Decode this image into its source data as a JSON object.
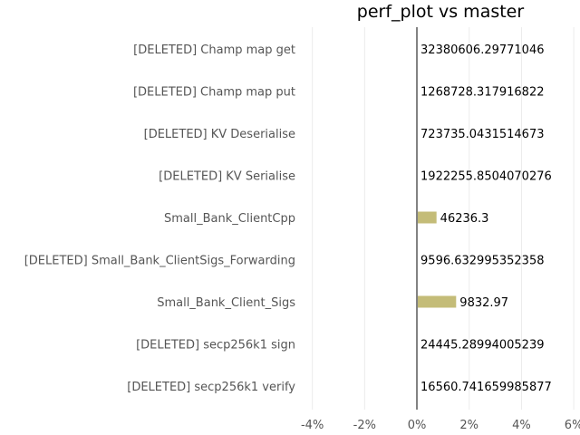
{
  "chart_data": {
    "type": "bar",
    "orientation": "horizontal",
    "title": "perf_plot vs master",
    "xlabel": "",
    "ylabel": "",
    "xlim": [
      -4.3,
      6.1
    ],
    "xticks": [
      -4,
      -2,
      0,
      2,
      4,
      6
    ],
    "xtick_labels": [
      "-4%",
      "-2%",
      "0%",
      "2%",
      "4%",
      "6%"
    ],
    "grid": "vertical",
    "bar_color": "#c4bc78",
    "zero_line_color": "#808080",
    "categories": [
      "[DELETED] Champ map get",
      "[DELETED] Champ map put",
      "[DELETED] KV Deserialise",
      "[DELETED] KV Serialise",
      "Small_Bank_ClientCpp",
      "[DELETED] Small_Bank_ClientSigs_Forwarding",
      "Small_Bank_Client_Sigs",
      "[DELETED] secp256k1 sign",
      "[DELETED] secp256k1 verify"
    ],
    "values": [
      0,
      0,
      0,
      0,
      0.75,
      0,
      1.5,
      0,
      0
    ],
    "value_labels": [
      "32380606.29771046",
      "1268728.317916822",
      "723735.0431514673",
      "1922255.8504070276",
      "46236.3",
      "9596.632995352358",
      "9832.97",
      "24445.28994005239",
      "16560.741659985877"
    ]
  }
}
